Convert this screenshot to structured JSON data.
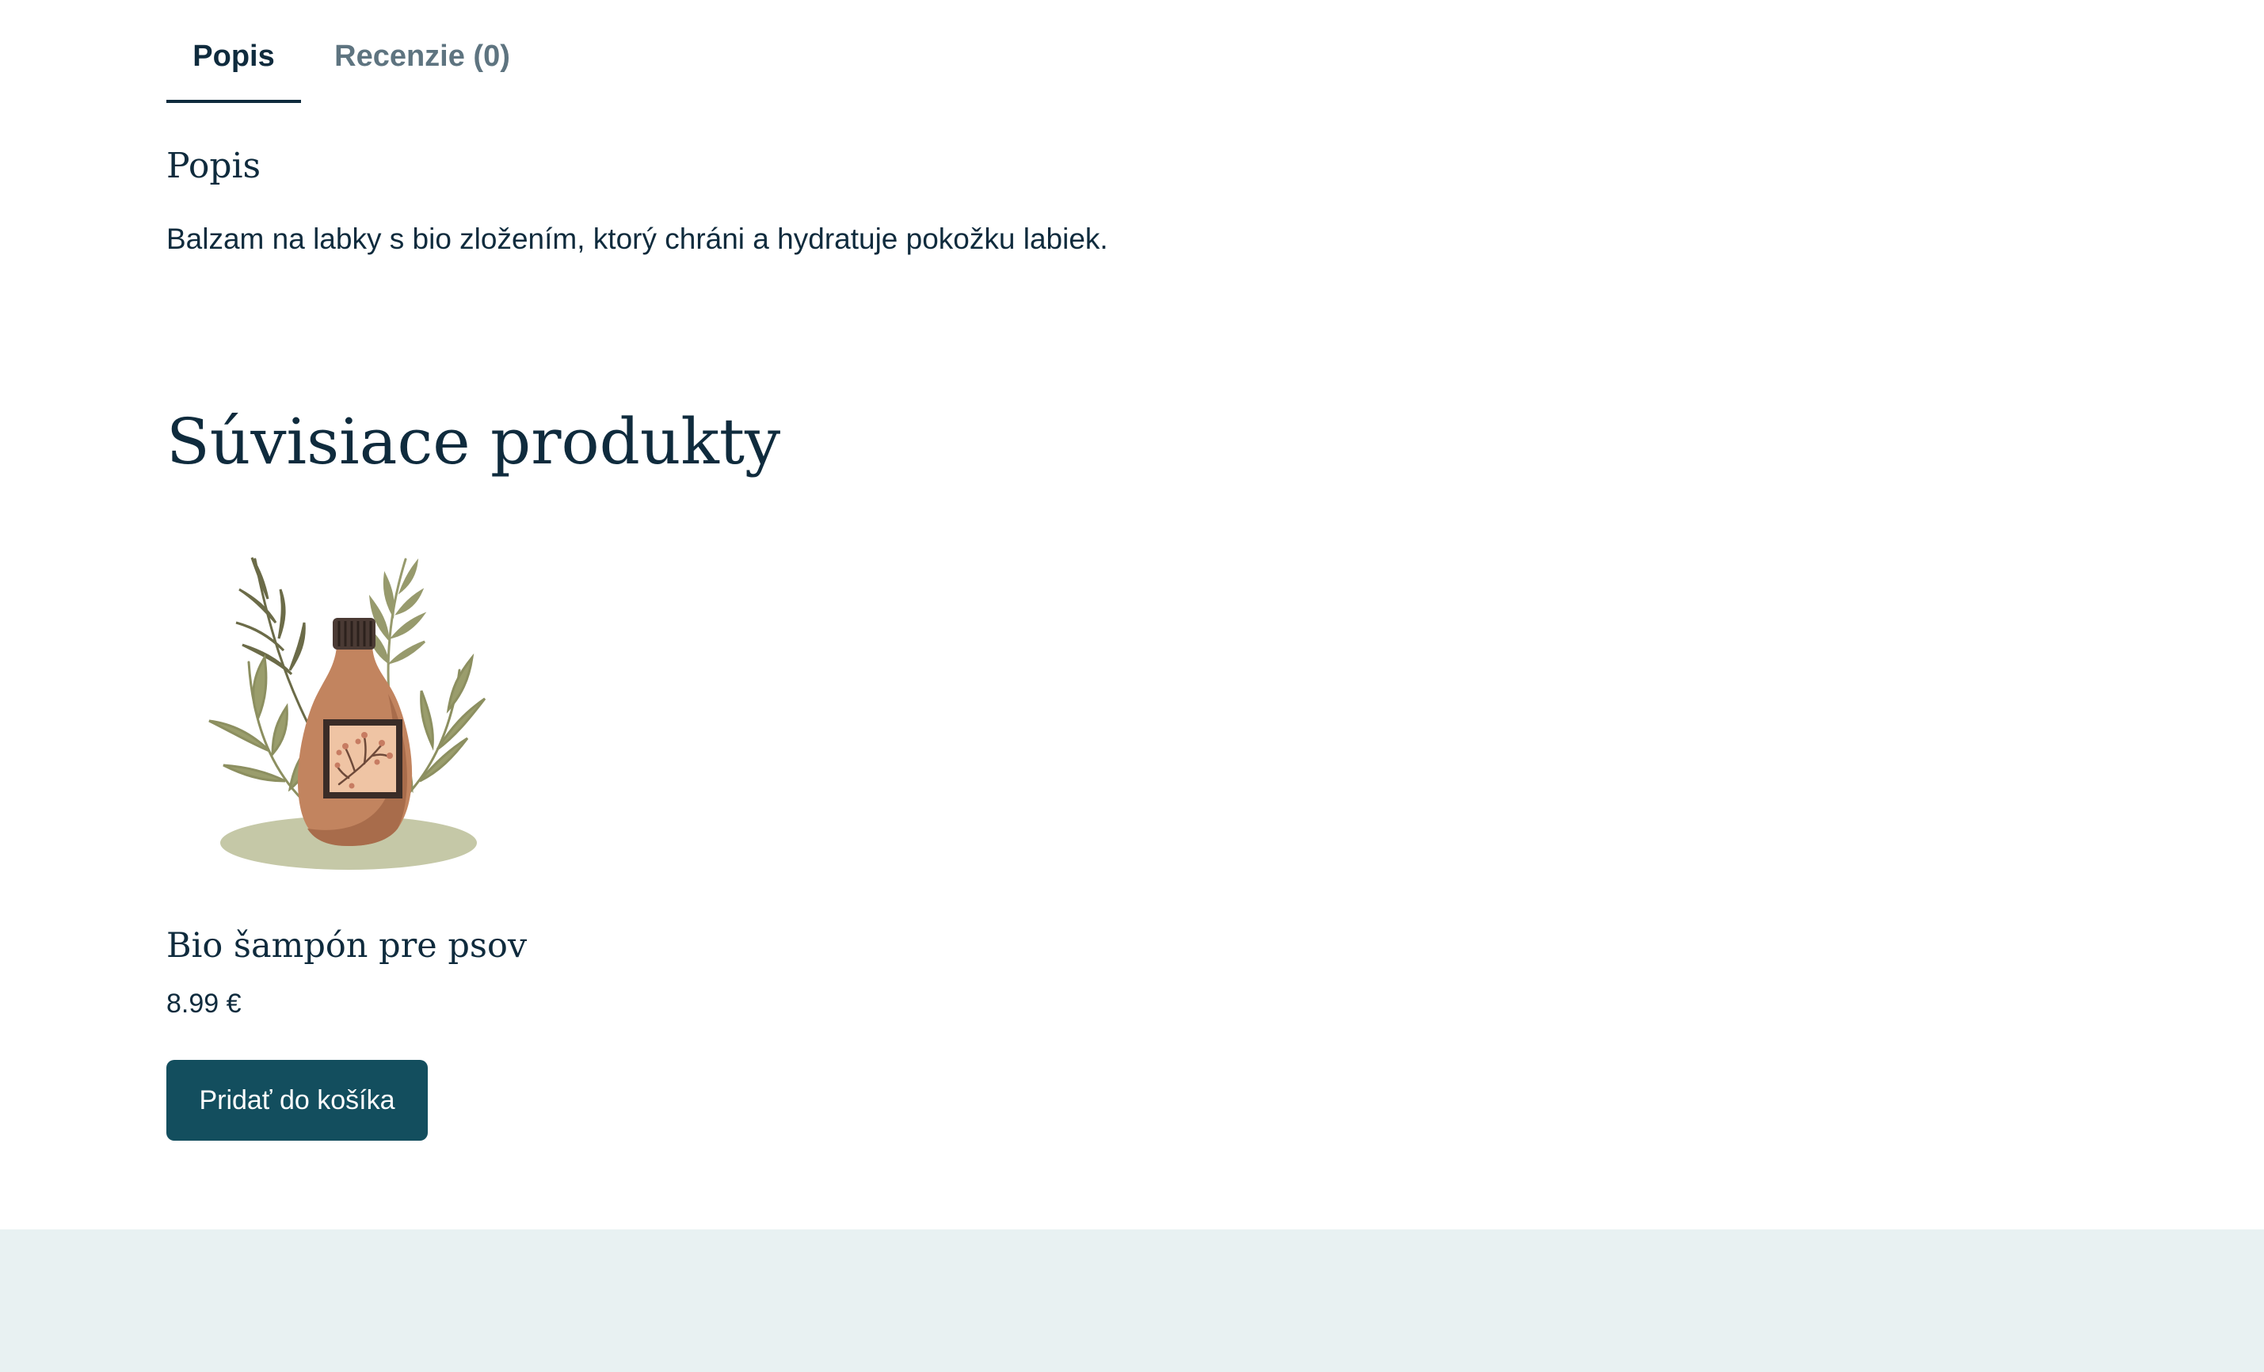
{
  "tabs": [
    {
      "label": "Popis",
      "active": true
    },
    {
      "label": "Recenzie (0)",
      "active": false
    }
  ],
  "description": {
    "title": "Popis",
    "text": "Balzam na labky s bio zložením, ktorý chráni a hydratuje pokožku labiek."
  },
  "related": {
    "title": "Súvisiace produkty",
    "products": [
      {
        "name": "Bio šampón pre psov",
        "price": "8.99 €",
        "button_label": "Pridať do košíka",
        "image_icon": "shampoo-bottle-with-leaves-illustration"
      }
    ]
  },
  "colors": {
    "text": "#0f2b3d",
    "tab_inactive": "#5e7480",
    "button_bg": "#134e5e",
    "footer_bg": "#e8f1f2"
  }
}
